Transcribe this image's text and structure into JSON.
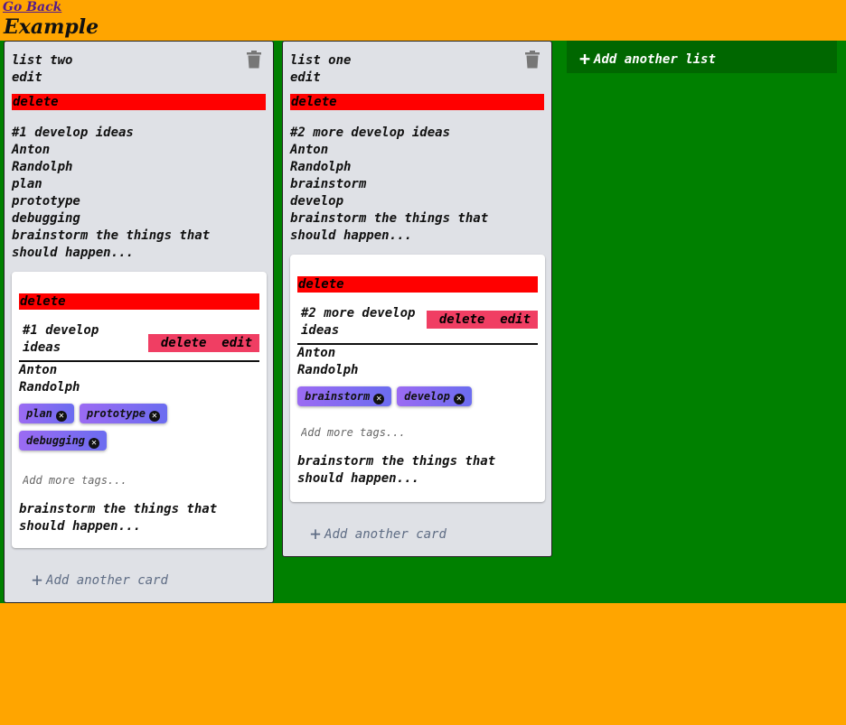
{
  "nav": {
    "go_back": "Go Back"
  },
  "board": {
    "title": "Example",
    "add_list_label": "Add another list"
  },
  "lists": [
    {
      "title": "list two",
      "edit": "edit",
      "delete": "delete",
      "lines": [
        "#1 develop ideas",
        "Anton",
        "Randolph",
        "plan",
        "prototype",
        "debugging",
        "brainstorm the things that should happen..."
      ],
      "card": {
        "delete": "delete",
        "title": "#1 develop ideas",
        "delete_action": "delete",
        "edit_action": "edit",
        "lines": [
          "Anton",
          "Randolph"
        ],
        "tags": [
          "plan",
          "prototype",
          "debugging"
        ],
        "add_tags_placeholder": "Add more tags...",
        "description": "brainstorm the things that should happen..."
      },
      "add_card_label": "Add another card"
    },
    {
      "title": "list one",
      "edit": "edit",
      "delete": "delete",
      "lines": [
        "#2 more develop ideas",
        "Anton",
        "Randolph",
        "brainstorm",
        "develop",
        "brainstorm the things that should happen..."
      ],
      "card": {
        "delete": "delete",
        "title": "#2 more develop ideas",
        "delete_action": "delete",
        "edit_action": "edit",
        "lines": [
          "Anton",
          "Randolph"
        ],
        "tags": [
          "brainstorm",
          "develop"
        ],
        "add_tags_placeholder": "Add more tags...",
        "description": "brainstorm the things that should happen..."
      },
      "add_card_label": "Add another card"
    }
  ],
  "colors": {
    "page_bg": "#ffa500",
    "board_bg": "#008000",
    "delete_red": "#ff0000",
    "card_action_pink": "#f03e63",
    "tag_purple": "#8b6cf1"
  }
}
